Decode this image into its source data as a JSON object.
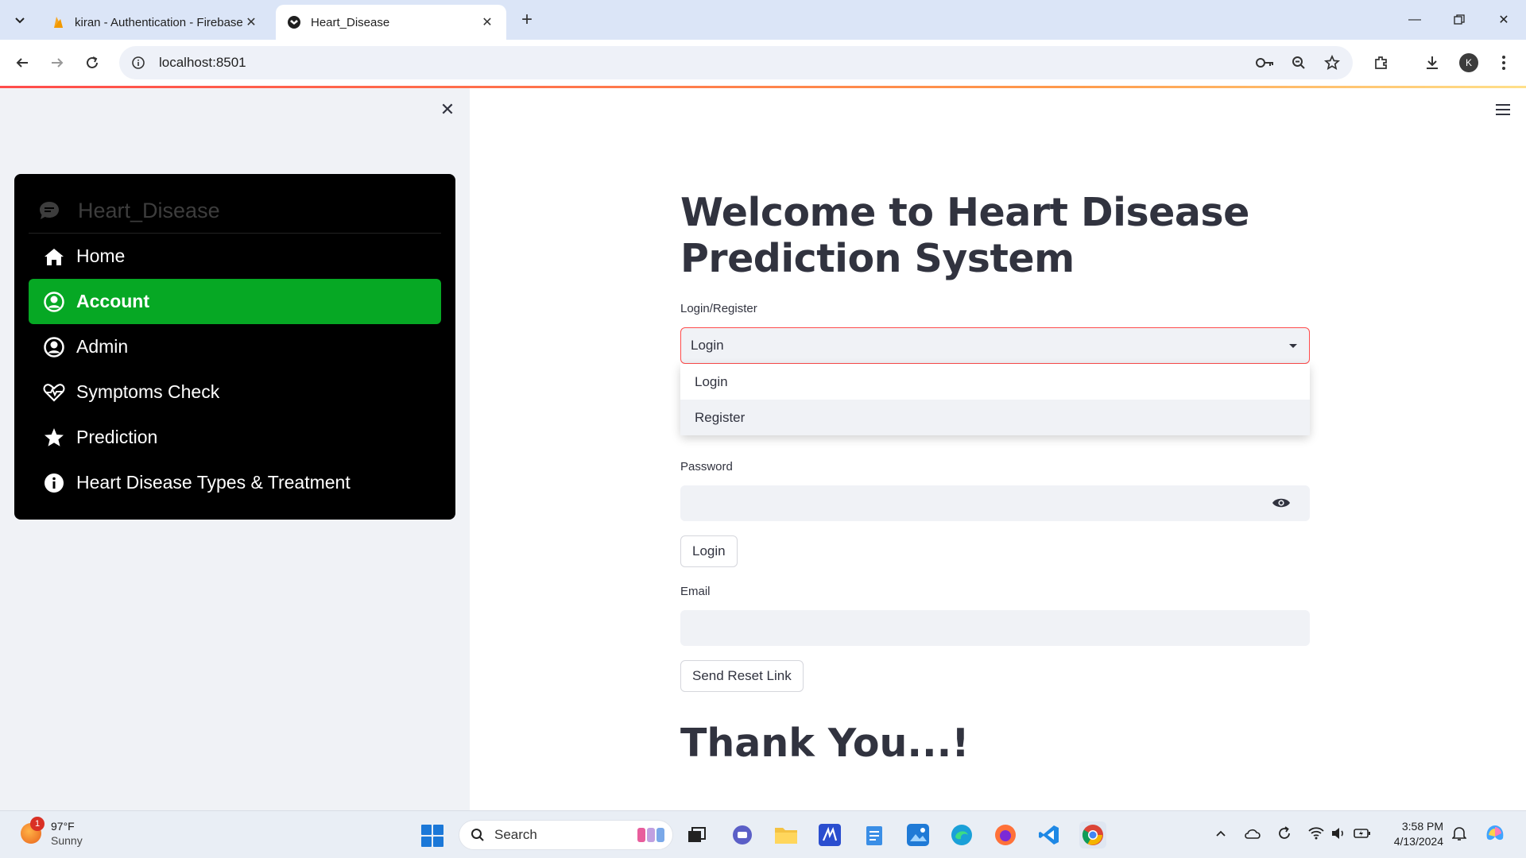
{
  "browser": {
    "tabs": [
      {
        "title": "kiran - Authentication - Firebase",
        "active": false
      },
      {
        "title": "Heart_Disease",
        "active": true
      }
    ],
    "url": "localhost:8501",
    "profile_initial": "K"
  },
  "sidebar": {
    "menu_title": "Heart_Disease",
    "items": [
      {
        "label": "Home",
        "icon": "house-icon",
        "selected": false
      },
      {
        "label": "Account",
        "icon": "person-circle-icon",
        "selected": true
      },
      {
        "label": "Admin",
        "icon": "person-circle-icon",
        "selected": false
      },
      {
        "label": "Symptoms Check",
        "icon": "heart-pulse-icon",
        "selected": false
      },
      {
        "label": "Prediction",
        "icon": "star-icon",
        "selected": false
      },
      {
        "label": "Heart Disease Types & Treatment",
        "icon": "info-circle-icon",
        "selected": false
      }
    ],
    "accent_color": "#06a824"
  },
  "main": {
    "title": "Welcome to Heart Disease Prediction System",
    "select_label": "Login/Register",
    "select_value": "Login",
    "dropdown_options": [
      "Login",
      "Register"
    ],
    "password_label": "Password",
    "login_button": "Login",
    "email_label": "Email",
    "reset_button": "Send Reset Link",
    "thanks": "Thank You...!"
  },
  "taskbar": {
    "weather_temp": "97°F",
    "weather_desc": "Sunny",
    "weather_badge": "1",
    "search_placeholder": "Search",
    "time": "3:58 PM",
    "date": "4/13/2024"
  }
}
